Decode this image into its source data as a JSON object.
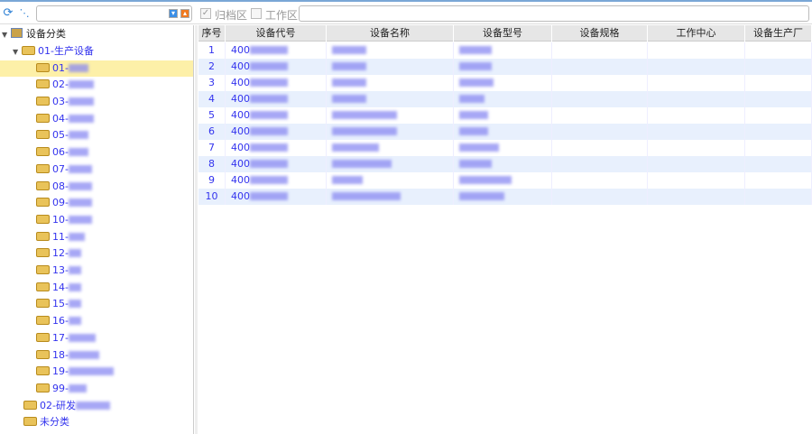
{
  "toolbar": {
    "refresh_icon": "refresh-icon",
    "tree_icon": "tree-structure-icon",
    "search_placeholder": "",
    "archive_label": "归档区",
    "archive_checked": true,
    "work_label": "工作区",
    "work_checked": false,
    "filter_value": ""
  },
  "tree": {
    "root": "设备分类",
    "group1": "01-生产设备",
    "children": [
      "01-",
      "02-",
      "03-",
      "04-",
      "05-",
      "06-",
      "07-",
      "08-",
      "09-",
      "10-",
      "11-",
      "12-",
      "13-",
      "14-",
      "15-",
      "16-",
      "17-",
      "18-",
      "19-",
      "99-"
    ],
    "group2": "02-研发",
    "group3": "未分类",
    "selected_index": 0
  },
  "grid": {
    "columns": [
      "序号",
      "设备代号",
      "设备名称",
      "设备型号",
      "设备规格",
      "工作中心",
      "设备生产厂"
    ],
    "rows": [
      {
        "no": "1",
        "code": "400"
      },
      {
        "no": "2",
        "code": "400"
      },
      {
        "no": "3",
        "code": "400"
      },
      {
        "no": "4",
        "code": "400"
      },
      {
        "no": "5",
        "code": "400"
      },
      {
        "no": "6",
        "code": "400"
      },
      {
        "no": "7",
        "code": "400"
      },
      {
        "no": "8",
        "code": "400"
      },
      {
        "no": "9",
        "code": "400"
      },
      {
        "no": "10",
        "code": "400"
      }
    ]
  },
  "colors": {
    "accent": "#3333ee",
    "selected": "#fdf0a8",
    "alt_row": "#e8f0fd"
  }
}
